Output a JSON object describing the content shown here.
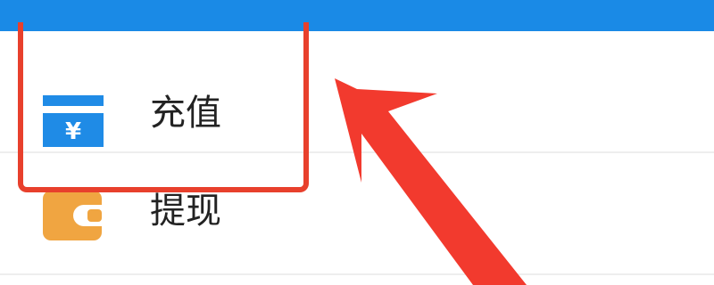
{
  "colors": {
    "header_blue": "#1a8ae6",
    "recharge_icon_blue": "#1f8be6",
    "withdraw_icon_orange": "#f0a541",
    "highlight_red": "#e8402c",
    "arrow_red": "#f23a2e"
  },
  "menu": {
    "items": [
      {
        "label": "充值",
        "icon": "recharge-card-icon",
        "icon_glyph": "¥",
        "highlighted": true
      },
      {
        "label": "提现",
        "icon": "wallet-icon",
        "highlighted": false
      }
    ]
  },
  "annotation": {
    "type": "arrow",
    "points_to": "充值"
  }
}
